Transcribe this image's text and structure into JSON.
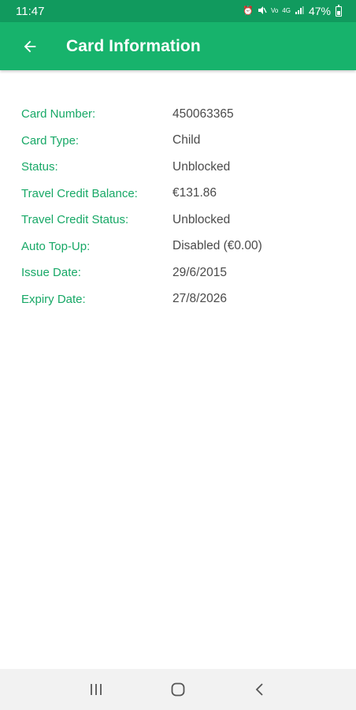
{
  "status_bar": {
    "time": "11:47",
    "battery": "47%"
  },
  "app_bar": {
    "title": "Card Information",
    "back_icon": "arrow-left-icon"
  },
  "card_info": {
    "rows": [
      {
        "label": "Card Number:",
        "value": "450063365"
      },
      {
        "label": "Card Type:",
        "value": "Child"
      },
      {
        "label": "Status:",
        "value": "Unblocked"
      },
      {
        "label": "Travel Credit Balance:",
        "value": "€131.86"
      },
      {
        "label": "Travel Credit Status:",
        "value": "Unblocked"
      },
      {
        "label": "Auto Top-Up:",
        "value": "Disabled (€0.00)"
      },
      {
        "label": "Issue Date:",
        "value": "29/6/2015"
      },
      {
        "label": "Expiry Date:",
        "value": "27/8/2026"
      }
    ]
  },
  "nav_bar": {
    "icons": [
      "recent-apps-icon",
      "home-icon",
      "back-icon"
    ]
  },
  "colors": {
    "status_bar": "#119a5e",
    "app_bar": "#17b36c",
    "label": "#17a866",
    "value": "#4a4a4a"
  }
}
